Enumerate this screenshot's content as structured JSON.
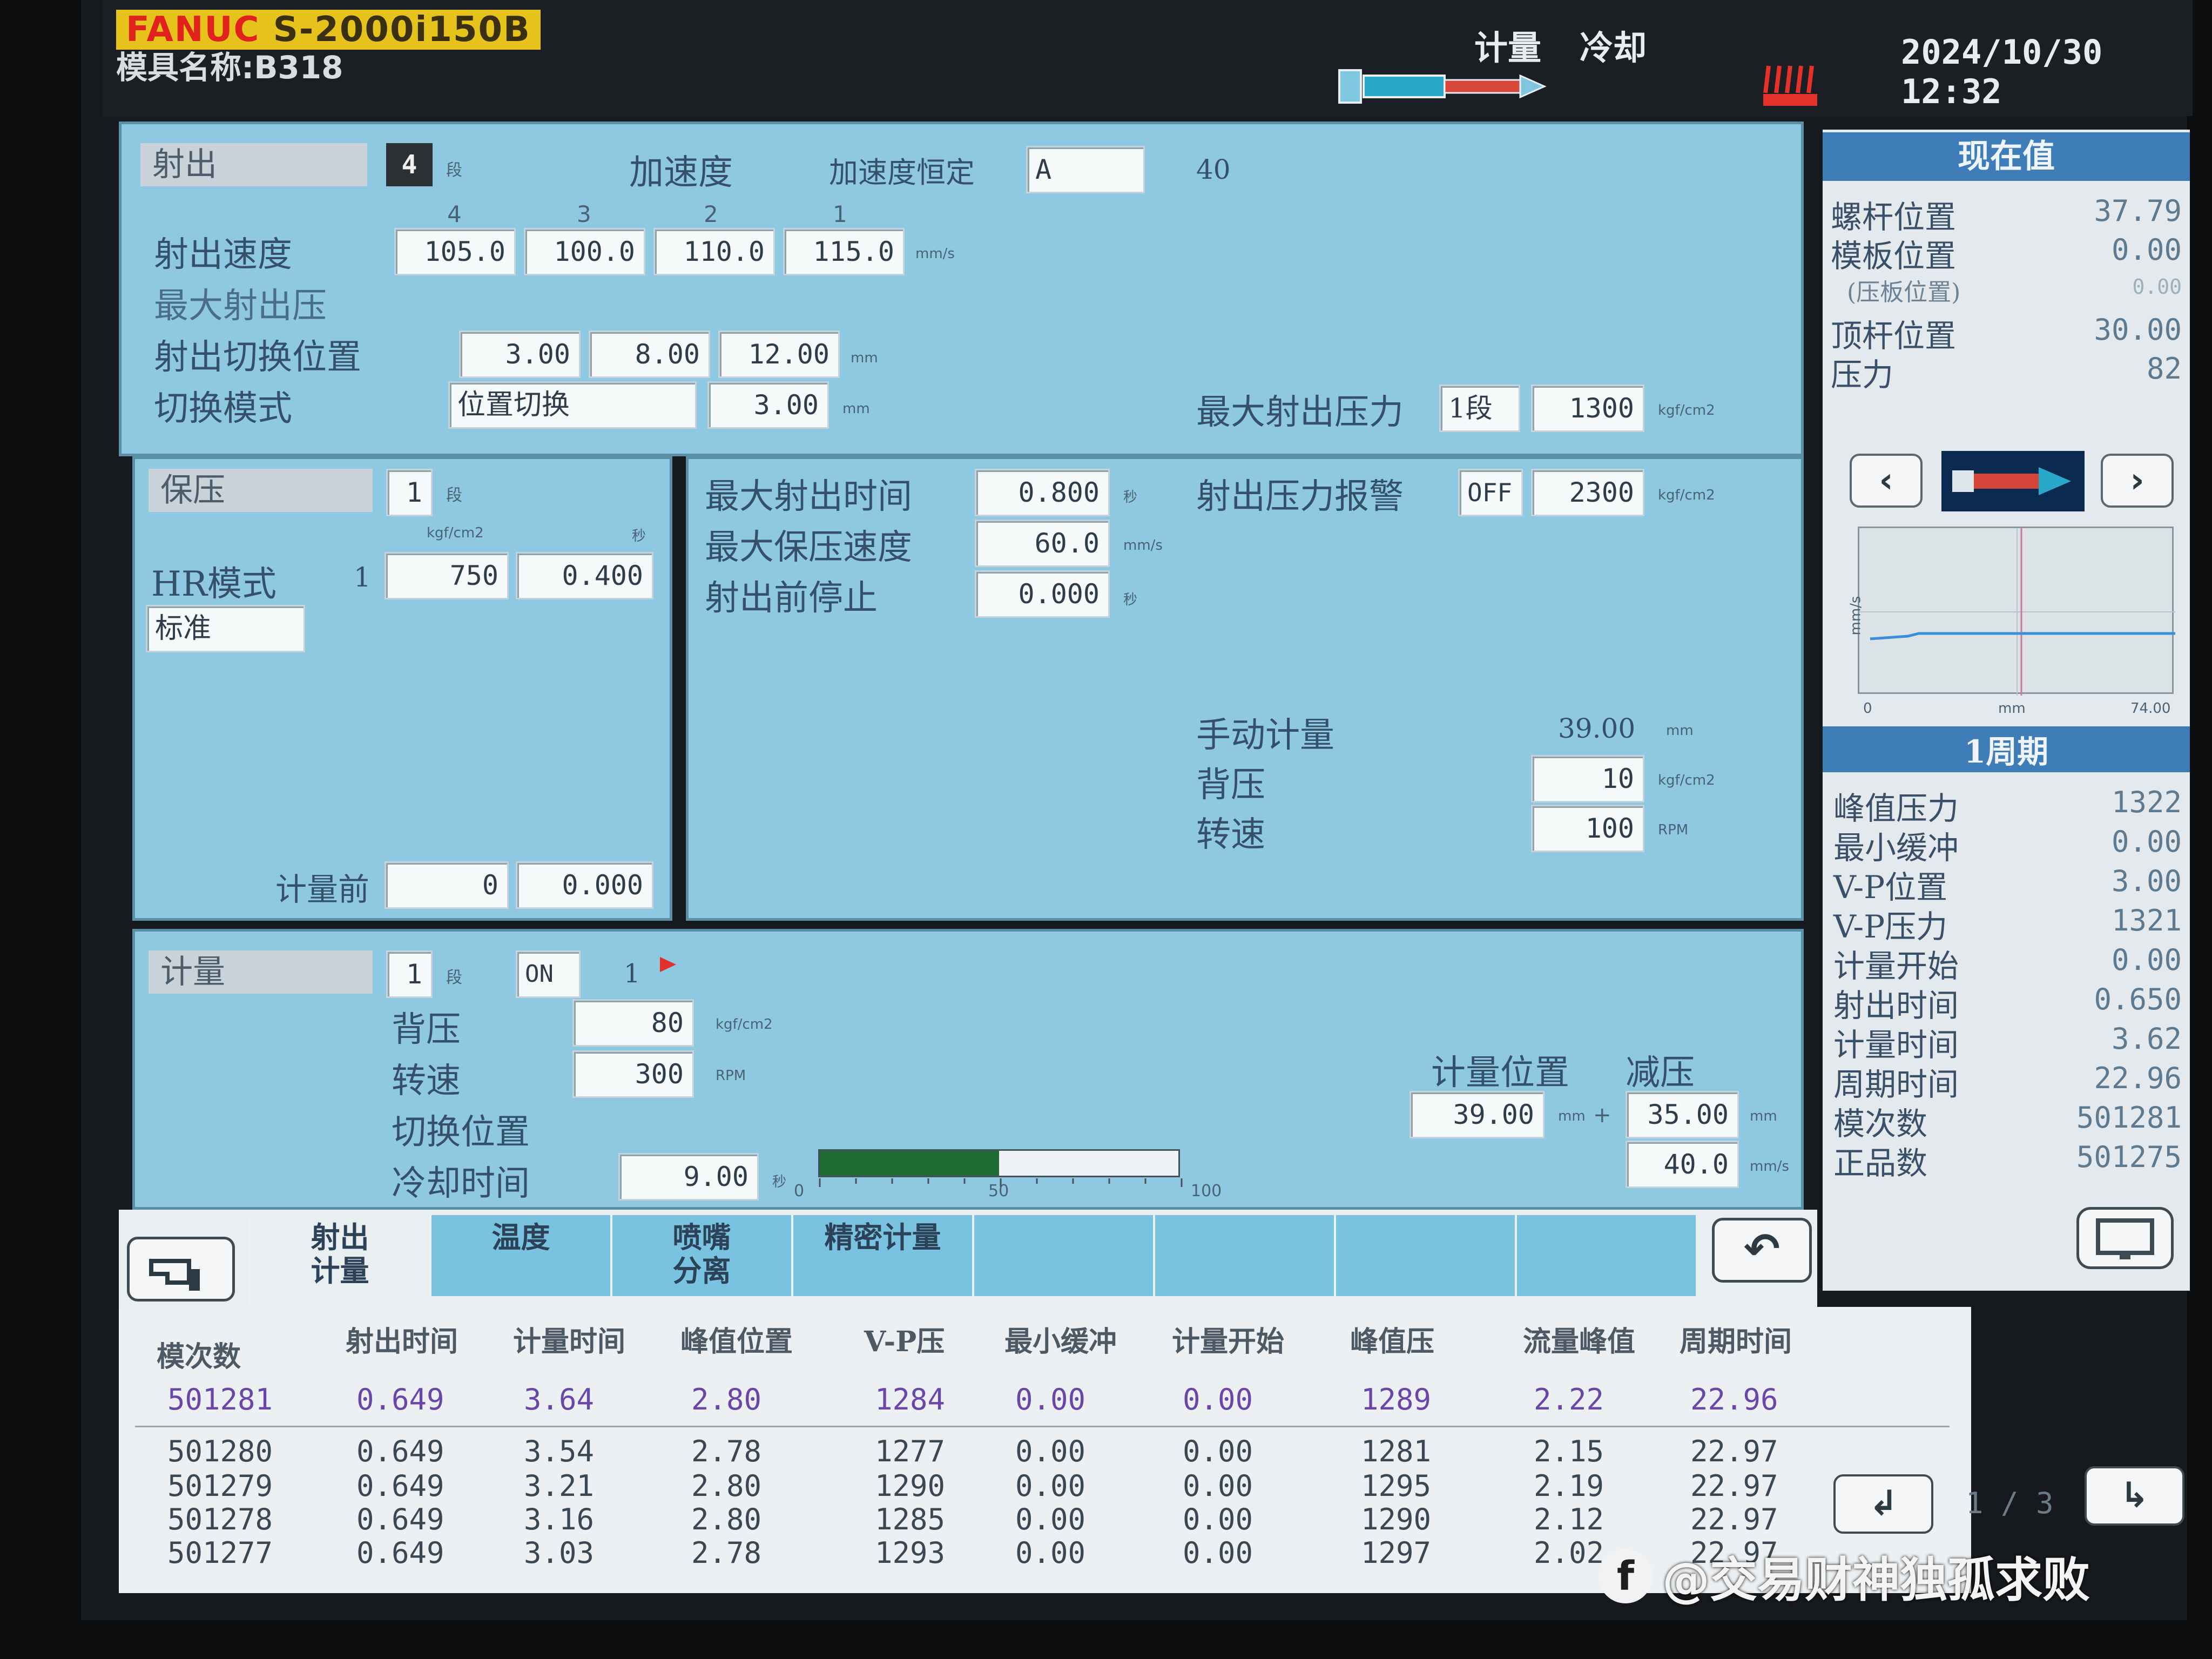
{
  "header": {
    "brand_red": "FANUC",
    "brand_model": "S-2000i150B",
    "mold_name": "模具名称:B318",
    "status_metering": "计量",
    "status_cooling": "冷却",
    "datetime": "2024/10/30 12:32"
  },
  "injection": {
    "title": "射出",
    "stages": "4",
    "stages_unit": "段",
    "accel_label": "加速度",
    "accel_const_label": "加速度恒定",
    "accel_const_value": "A",
    "accel_value": "40",
    "stage_numbers": [
      "4",
      "3",
      "2",
      "1"
    ],
    "speed_label": "射出速度",
    "speeds": [
      "105.0",
      "100.0",
      "110.0",
      "115.0"
    ],
    "speed_unit": "mm/s",
    "max_pressure_label": "最大射出压",
    "switch_pos_label": "射出切换位置",
    "switch_positions": [
      "3.00",
      "8.00",
      "12.00"
    ],
    "switch_pos_unit": "mm",
    "switch_mode_label": "切换模式",
    "switch_mode_value": "位置切换",
    "switch_mode_pos": "3.00",
    "switch_mode_unit": "mm",
    "max_inj_pressure_label": "最大射出压力",
    "max_inj_pressure_stage": "1段",
    "max_inj_pressure_value": "1300",
    "pressure_unit": "kgf/cm2"
  },
  "hold": {
    "title": "保压",
    "stages": "1",
    "stages_unit": "段",
    "col_unit_pressure": "kgf/cm2",
    "col_unit_time": "秒",
    "hr_mode_label": "HR模式",
    "row_index": "1",
    "pressure": "750",
    "time": "0.400",
    "mode_value": "标准",
    "pre_metering_label": "计量前",
    "pre_metering_pressure": "0",
    "pre_metering_time": "0.000"
  },
  "limits": {
    "max_inj_time_label": "最大射出时间",
    "max_inj_time": "0.800",
    "max_inj_time_unit": "秒",
    "max_hold_speed_label": "最大保压速度",
    "max_hold_speed": "60.0",
    "max_hold_speed_unit": "mm/s",
    "pre_inj_stop_label": "射出前停止",
    "pre_inj_stop": "0.000",
    "pre_inj_stop_unit": "秒",
    "inj_pressure_alarm_label": "射出压力报警",
    "inj_pressure_alarm_state": "OFF",
    "inj_pressure_alarm_value": "2300",
    "inj_pressure_alarm_unit": "kgf/cm2",
    "manual_metering_label": "手动计量",
    "manual_metering_value": "39.00",
    "manual_metering_unit": "mm",
    "back_pressure_label": "背压",
    "back_pressure_value": "10",
    "back_pressure_unit": "kgf/cm2",
    "rpm_label": "转速",
    "rpm_value": "100",
    "rpm_unit": "RPM"
  },
  "metering": {
    "title": "计量",
    "stages": "1",
    "stages_unit": "段",
    "state": "ON",
    "index": "1",
    "back_pressure_label": "背压",
    "back_pressure": "80",
    "back_pressure_unit": "kgf/cm2",
    "rpm_label": "转速",
    "rpm": "300",
    "rpm_unit": "RPM",
    "switch_pos_label": "切换位置",
    "cooling_time_label": "冷却时间",
    "cooling_time": "9.00",
    "cooling_time_unit": "秒",
    "progress_fraction": 0.5,
    "progress_ticks": [
      "0",
      "50",
      "100"
    ],
    "metering_pos_label": "计量位置",
    "decompression_label": "减压",
    "metering_pos": "39.00",
    "metering_pos_unit": "mm",
    "plus": "+",
    "decompression_pos": "35.00",
    "decompression_pos_unit": "mm",
    "decompression_speed": "40.0",
    "decompression_speed_unit": "mm/s"
  },
  "current_values": {
    "title": "现在值",
    "items": [
      {
        "label": "螺杆位置",
        "value": "37.79"
      },
      {
        "label": "模板位置",
        "value": "0.00"
      },
      {
        "label": "(压板位置)",
        "value": "0.00"
      },
      {
        "label": "顶杆位置",
        "value": "30.00"
      },
      {
        "label": "压力",
        "value": "82"
      }
    ],
    "graph_ylabel": "mm/s",
    "graph_xlabel": "mm",
    "graph_xmin": "0",
    "graph_xmax": "74.00"
  },
  "cycle": {
    "title": "1周期",
    "items": [
      {
        "label": "峰值压力",
        "value": "1322"
      },
      {
        "label": "最小缓冲",
        "value": "0.00"
      },
      {
        "label": "V-P位置",
        "value": "3.00"
      },
      {
        "label": "V-P压力",
        "value": "1321"
      },
      {
        "label": "计量开始",
        "value": "0.00"
      },
      {
        "label": "射出时间",
        "value": "0.650"
      },
      {
        "label": "计量时间",
        "value": "3.62"
      },
      {
        "label": "周期时间",
        "value": "22.96"
      },
      {
        "label": "模次数",
        "value": "501281"
      },
      {
        "label": "正品数",
        "value": "501275"
      }
    ]
  },
  "tabs": [
    "射出\n计量",
    "温度",
    "喷嘴\n分离",
    "精密计量"
  ],
  "table": {
    "headers": [
      "模次数",
      "射出时间",
      "计量时间",
      "峰值位置",
      "V-P压",
      "最小缓冲",
      "计量开始",
      "峰值压",
      "流量峰值",
      "周期时间"
    ],
    "rows": [
      [
        "501281",
        "0.649",
        "3.64",
        "2.80",
        "1284",
        "0.00",
        "0.00",
        "1289",
        "2.22",
        "22.96"
      ],
      [
        "501280",
        "0.649",
        "3.54",
        "2.78",
        "1277",
        "0.00",
        "0.00",
        "1281",
        "2.15",
        "22.97"
      ],
      [
        "501279",
        "0.649",
        "3.21",
        "2.80",
        "1290",
        "0.00",
        "0.00",
        "1295",
        "2.19",
        "22.97"
      ],
      [
        "501278",
        "0.649",
        "3.16",
        "2.80",
        "1285",
        "0.00",
        "0.00",
        "1290",
        "2.12",
        "22.97"
      ],
      [
        "501277",
        "0.649",
        "3.03",
        "2.78",
        "1293",
        "0.00",
        "0.00",
        "1297",
        "2.02",
        "22.97"
      ]
    ],
    "page": "1 / 3"
  },
  "watermark": "@交易财神独孤求败",
  "colors": {
    "panel": "#8fc9e1",
    "title_bar": "#3f7db8",
    "progress": "#1f6b34",
    "brand_yellow": "#e6c31a",
    "brand_red": "#e0211c"
  }
}
